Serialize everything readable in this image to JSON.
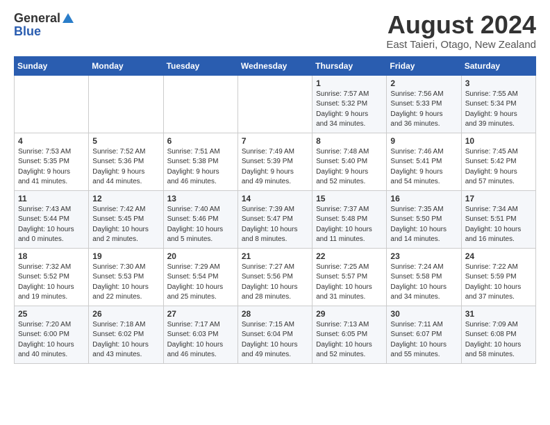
{
  "logo": {
    "general": "General",
    "blue": "Blue"
  },
  "title": "August 2024",
  "location": "East Taieri, Otago, New Zealand",
  "headers": [
    "Sunday",
    "Monday",
    "Tuesday",
    "Wednesday",
    "Thursday",
    "Friday",
    "Saturday"
  ],
  "weeks": [
    [
      {
        "day": "",
        "info": ""
      },
      {
        "day": "",
        "info": ""
      },
      {
        "day": "",
        "info": ""
      },
      {
        "day": "",
        "info": ""
      },
      {
        "day": "1",
        "info": "Sunrise: 7:57 AM\nSunset: 5:32 PM\nDaylight: 9 hours\nand 34 minutes."
      },
      {
        "day": "2",
        "info": "Sunrise: 7:56 AM\nSunset: 5:33 PM\nDaylight: 9 hours\nand 36 minutes."
      },
      {
        "day": "3",
        "info": "Sunrise: 7:55 AM\nSunset: 5:34 PM\nDaylight: 9 hours\nand 39 minutes."
      }
    ],
    [
      {
        "day": "4",
        "info": "Sunrise: 7:53 AM\nSunset: 5:35 PM\nDaylight: 9 hours\nand 41 minutes."
      },
      {
        "day": "5",
        "info": "Sunrise: 7:52 AM\nSunset: 5:36 PM\nDaylight: 9 hours\nand 44 minutes."
      },
      {
        "day": "6",
        "info": "Sunrise: 7:51 AM\nSunset: 5:38 PM\nDaylight: 9 hours\nand 46 minutes."
      },
      {
        "day": "7",
        "info": "Sunrise: 7:49 AM\nSunset: 5:39 PM\nDaylight: 9 hours\nand 49 minutes."
      },
      {
        "day": "8",
        "info": "Sunrise: 7:48 AM\nSunset: 5:40 PM\nDaylight: 9 hours\nand 52 minutes."
      },
      {
        "day": "9",
        "info": "Sunrise: 7:46 AM\nSunset: 5:41 PM\nDaylight: 9 hours\nand 54 minutes."
      },
      {
        "day": "10",
        "info": "Sunrise: 7:45 AM\nSunset: 5:42 PM\nDaylight: 9 hours\nand 57 minutes."
      }
    ],
    [
      {
        "day": "11",
        "info": "Sunrise: 7:43 AM\nSunset: 5:44 PM\nDaylight: 10 hours\nand 0 minutes."
      },
      {
        "day": "12",
        "info": "Sunrise: 7:42 AM\nSunset: 5:45 PM\nDaylight: 10 hours\nand 2 minutes."
      },
      {
        "day": "13",
        "info": "Sunrise: 7:40 AM\nSunset: 5:46 PM\nDaylight: 10 hours\nand 5 minutes."
      },
      {
        "day": "14",
        "info": "Sunrise: 7:39 AM\nSunset: 5:47 PM\nDaylight: 10 hours\nand 8 minutes."
      },
      {
        "day": "15",
        "info": "Sunrise: 7:37 AM\nSunset: 5:48 PM\nDaylight: 10 hours\nand 11 minutes."
      },
      {
        "day": "16",
        "info": "Sunrise: 7:35 AM\nSunset: 5:50 PM\nDaylight: 10 hours\nand 14 minutes."
      },
      {
        "day": "17",
        "info": "Sunrise: 7:34 AM\nSunset: 5:51 PM\nDaylight: 10 hours\nand 16 minutes."
      }
    ],
    [
      {
        "day": "18",
        "info": "Sunrise: 7:32 AM\nSunset: 5:52 PM\nDaylight: 10 hours\nand 19 minutes."
      },
      {
        "day": "19",
        "info": "Sunrise: 7:30 AM\nSunset: 5:53 PM\nDaylight: 10 hours\nand 22 minutes."
      },
      {
        "day": "20",
        "info": "Sunrise: 7:29 AM\nSunset: 5:54 PM\nDaylight: 10 hours\nand 25 minutes."
      },
      {
        "day": "21",
        "info": "Sunrise: 7:27 AM\nSunset: 5:56 PM\nDaylight: 10 hours\nand 28 minutes."
      },
      {
        "day": "22",
        "info": "Sunrise: 7:25 AM\nSunset: 5:57 PM\nDaylight: 10 hours\nand 31 minutes."
      },
      {
        "day": "23",
        "info": "Sunrise: 7:24 AM\nSunset: 5:58 PM\nDaylight: 10 hours\nand 34 minutes."
      },
      {
        "day": "24",
        "info": "Sunrise: 7:22 AM\nSunset: 5:59 PM\nDaylight: 10 hours\nand 37 minutes."
      }
    ],
    [
      {
        "day": "25",
        "info": "Sunrise: 7:20 AM\nSunset: 6:00 PM\nDaylight: 10 hours\nand 40 minutes."
      },
      {
        "day": "26",
        "info": "Sunrise: 7:18 AM\nSunset: 6:02 PM\nDaylight: 10 hours\nand 43 minutes."
      },
      {
        "day": "27",
        "info": "Sunrise: 7:17 AM\nSunset: 6:03 PM\nDaylight: 10 hours\nand 46 minutes."
      },
      {
        "day": "28",
        "info": "Sunrise: 7:15 AM\nSunset: 6:04 PM\nDaylight: 10 hours\nand 49 minutes."
      },
      {
        "day": "29",
        "info": "Sunrise: 7:13 AM\nSunset: 6:05 PM\nDaylight: 10 hours\nand 52 minutes."
      },
      {
        "day": "30",
        "info": "Sunrise: 7:11 AM\nSunset: 6:07 PM\nDaylight: 10 hours\nand 55 minutes."
      },
      {
        "day": "31",
        "info": "Sunrise: 7:09 AM\nSunset: 6:08 PM\nDaylight: 10 hours\nand 58 minutes."
      }
    ]
  ]
}
